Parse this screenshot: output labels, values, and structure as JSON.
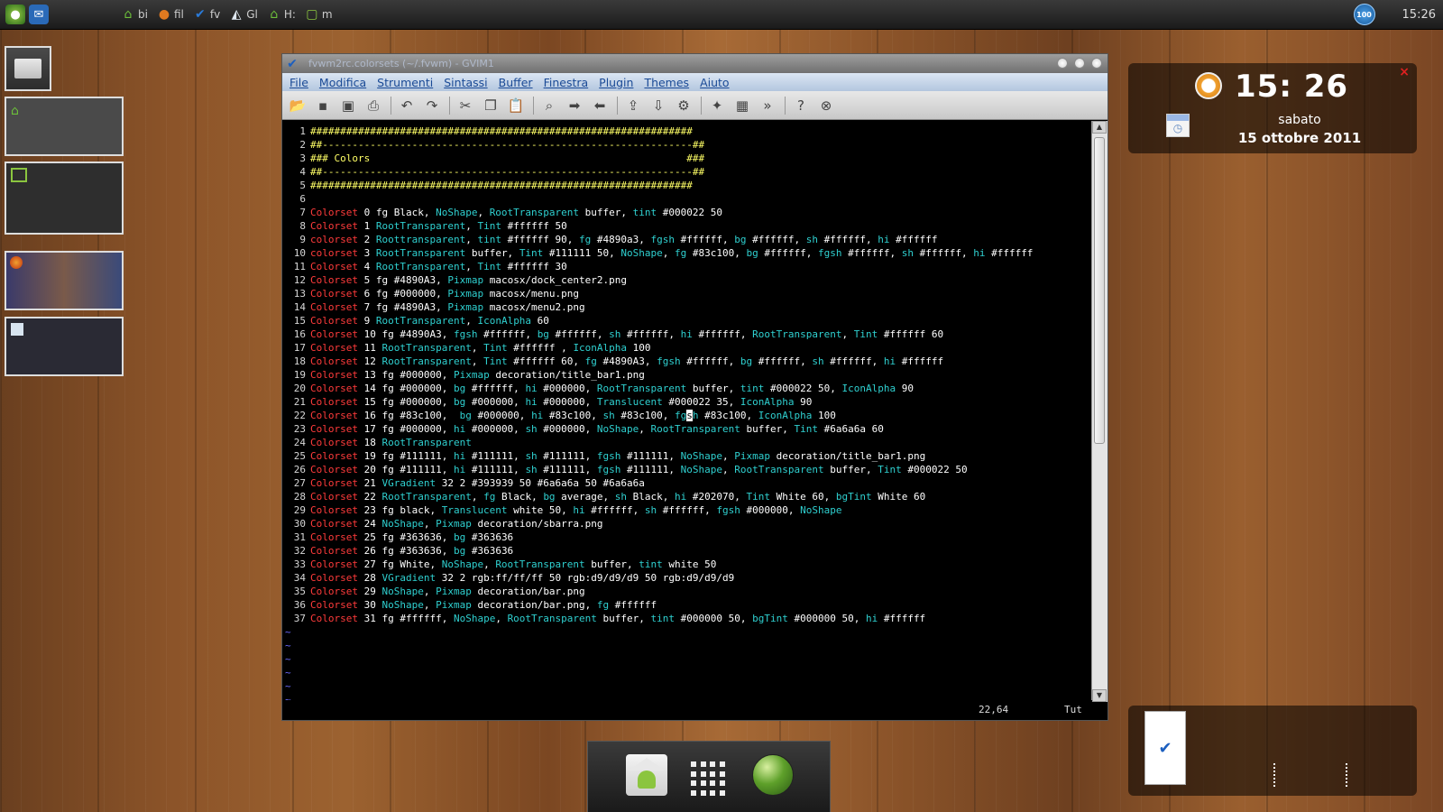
{
  "top_panel": {
    "launchers": [
      "globe-launcher",
      "chat-launcher"
    ],
    "tasks": [
      {
        "icon": "home-icon",
        "label": "bi"
      },
      {
        "icon": "firefox-icon",
        "label": "fil"
      },
      {
        "icon": "gvim-icon",
        "label": "fv"
      },
      {
        "icon": "inkscape-icon",
        "label": "Gl"
      },
      {
        "icon": "home-icon",
        "label": "H:"
      },
      {
        "icon": "terminal-icon",
        "label": "m"
      }
    ],
    "badge": "100",
    "clock": "15:26"
  },
  "gvim": {
    "title": "fvwm2rc.colorsets (~/.fvwm) - GVIM1",
    "menu": [
      "File",
      "Modifica",
      "Strumenti",
      "Sintassi",
      "Buffer",
      "Finestra",
      "Plugin",
      "Themes",
      "Aiuto"
    ],
    "status_pos": "22,64",
    "status_pct": "Tut"
  },
  "code_lines": [
    [
      [
        "#",
        "################################################################"
      ]
    ],
    [
      [
        "#",
        "##--------------------------------------------------------------##"
      ]
    ],
    [
      [
        "#",
        "### Colors                                                     ###"
      ]
    ],
    [
      [
        "#",
        "##--------------------------------------------------------------##"
      ]
    ],
    [
      [
        "#",
        "################################################################"
      ]
    ],
    [],
    [
      [
        "r",
        "Colorset"
      ],
      [
        "w",
        " 0 fg Black, "
      ],
      [
        "c",
        "NoShape"
      ],
      [
        "w",
        ", "
      ],
      [
        "c",
        "RootTransparent"
      ],
      [
        "w",
        " buffer, "
      ],
      [
        "c",
        "tint"
      ],
      [
        "w",
        " #000022 50"
      ]
    ],
    [
      [
        "r",
        "Colorset"
      ],
      [
        "w",
        " 1 "
      ],
      [
        "c",
        "RootTransparent"
      ],
      [
        "w",
        ", "
      ],
      [
        "c",
        "Tint"
      ],
      [
        "w",
        " #ffffff 50"
      ]
    ],
    [
      [
        "r",
        "colorset"
      ],
      [
        "w",
        " 2 "
      ],
      [
        "c",
        "Roottransparent"
      ],
      [
        "w",
        ", "
      ],
      [
        "c",
        "tint"
      ],
      [
        "w",
        " #ffffff 90, "
      ],
      [
        "c",
        "fg"
      ],
      [
        "w",
        " #4890a3, "
      ],
      [
        "c",
        "fgsh"
      ],
      [
        "w",
        " #ffffff, "
      ],
      [
        "c",
        "bg"
      ],
      [
        "w",
        " #ffffff, "
      ],
      [
        "c",
        "sh"
      ],
      [
        "w",
        " #ffffff, "
      ],
      [
        "c",
        "hi"
      ],
      [
        "w",
        " #ffffff"
      ]
    ],
    [
      [
        "r",
        "colorset"
      ],
      [
        "w",
        " 3 "
      ],
      [
        "c",
        "RootTransparent"
      ],
      [
        "w",
        " buffer, "
      ],
      [
        "c",
        "Tint"
      ],
      [
        "w",
        " #111111 50, "
      ],
      [
        "c",
        "NoShape"
      ],
      [
        "w",
        ", "
      ],
      [
        "c",
        "fg"
      ],
      [
        "w",
        " #83c100, "
      ],
      [
        "c",
        "bg"
      ],
      [
        "w",
        " #ffffff, "
      ],
      [
        "c",
        "fgsh"
      ],
      [
        "w",
        " #ffffff, "
      ],
      [
        "c",
        "sh"
      ],
      [
        "w",
        " #ffffff, "
      ],
      [
        "c",
        "hi"
      ],
      [
        "w",
        " #ffffff"
      ]
    ],
    [
      [
        "r",
        "Colorset"
      ],
      [
        "w",
        " 4 "
      ],
      [
        "c",
        "RootTransparent"
      ],
      [
        "w",
        ", "
      ],
      [
        "c",
        "Tint"
      ],
      [
        "w",
        " #ffffff 30"
      ]
    ],
    [
      [
        "r",
        "Colorset"
      ],
      [
        "w",
        " 5 fg #4890A3, "
      ],
      [
        "c",
        "Pixmap"
      ],
      [
        "w",
        " macosx/dock_center2.png"
      ]
    ],
    [
      [
        "r",
        "Colorset"
      ],
      [
        "w",
        " 6 fg #000000, "
      ],
      [
        "c",
        "Pixmap"
      ],
      [
        "w",
        " macosx/menu.png"
      ]
    ],
    [
      [
        "r",
        "Colorset"
      ],
      [
        "w",
        " 7 fg #4890A3, "
      ],
      [
        "c",
        "Pixmap"
      ],
      [
        "w",
        " macosx/menu2.png"
      ]
    ],
    [
      [
        "r",
        "Colorset"
      ],
      [
        "w",
        " 9 "
      ],
      [
        "c",
        "RootTransparent"
      ],
      [
        "w",
        ", "
      ],
      [
        "c",
        "IconAlpha"
      ],
      [
        "w",
        " 60"
      ]
    ],
    [
      [
        "r",
        "Colorset"
      ],
      [
        "w",
        " 10 fg #4890A3, "
      ],
      [
        "c",
        "fgsh"
      ],
      [
        "w",
        " #ffffff, "
      ],
      [
        "c",
        "bg"
      ],
      [
        "w",
        " #ffffff, "
      ],
      [
        "c",
        "sh"
      ],
      [
        "w",
        " #ffffff, "
      ],
      [
        "c",
        "hi"
      ],
      [
        "w",
        " #ffffff, "
      ],
      [
        "c",
        "RootTransparent"
      ],
      [
        "w",
        ", "
      ],
      [
        "c",
        "Tint"
      ],
      [
        "w",
        " #ffffff 60"
      ]
    ],
    [
      [
        "r",
        "Colorset"
      ],
      [
        "w",
        " 11 "
      ],
      [
        "c",
        "RootTransparent"
      ],
      [
        "w",
        ", "
      ],
      [
        "c",
        "Tint"
      ],
      [
        "w",
        " #ffffff , "
      ],
      [
        "c",
        "IconAlpha"
      ],
      [
        "w",
        " 100"
      ]
    ],
    [
      [
        "r",
        "Colorset"
      ],
      [
        "w",
        " 12 "
      ],
      [
        "c",
        "RootTransparent"
      ],
      [
        "w",
        ", "
      ],
      [
        "c",
        "Tint"
      ],
      [
        "w",
        " #ffffff 60, "
      ],
      [
        "c",
        "fg"
      ],
      [
        "w",
        " #4890A3, "
      ],
      [
        "c",
        "fgsh"
      ],
      [
        "w",
        " #ffffff, "
      ],
      [
        "c",
        "bg"
      ],
      [
        "w",
        " #ffffff, "
      ],
      [
        "c",
        "sh"
      ],
      [
        "w",
        " #ffffff, "
      ],
      [
        "c",
        "hi"
      ],
      [
        "w",
        " #ffffff"
      ]
    ],
    [
      [
        "r",
        "Colorset"
      ],
      [
        "w",
        " 13 fg #000000, "
      ],
      [
        "c",
        "Pixmap"
      ],
      [
        "w",
        " decoration/title_bar1.png"
      ]
    ],
    [
      [
        "r",
        "Colorset"
      ],
      [
        "w",
        " 14 fg #000000, "
      ],
      [
        "c",
        "bg"
      ],
      [
        "w",
        " #ffffff, "
      ],
      [
        "c",
        "hi"
      ],
      [
        "w",
        " #000000, "
      ],
      [
        "c",
        "RootTransparent"
      ],
      [
        "w",
        " buffer, "
      ],
      [
        "c",
        "tint"
      ],
      [
        "w",
        " #000022 50, "
      ],
      [
        "c",
        "IconAlpha"
      ],
      [
        "w",
        " 90"
      ]
    ],
    [
      [
        "r",
        "Colorset"
      ],
      [
        "w",
        " 15 fg #000000, "
      ],
      [
        "c",
        "bg"
      ],
      [
        "w",
        " #000000, "
      ],
      [
        "c",
        "hi"
      ],
      [
        "w",
        " #000000, "
      ],
      [
        "c",
        "Translucent"
      ],
      [
        "w",
        " #000022 35, "
      ],
      [
        "c",
        "IconAlpha"
      ],
      [
        "w",
        " 90"
      ]
    ],
    [
      [
        "r",
        "Colorset"
      ],
      [
        "w",
        " 16 fg #83c100,  "
      ],
      [
        "c",
        "bg"
      ],
      [
        "w",
        " #000000, "
      ],
      [
        "c",
        "hi"
      ],
      [
        "w",
        " #83c100, "
      ],
      [
        "c",
        "sh"
      ],
      [
        "w",
        " #83c100, "
      ],
      [
        "c",
        "fg"
      ],
      [
        "k",
        "s"
      ],
      [
        "c",
        "h"
      ],
      [
        "w",
        " #83c100, "
      ],
      [
        "c",
        "IconAlpha"
      ],
      [
        "w",
        " 100"
      ]
    ],
    [
      [
        "r",
        "Colorset"
      ],
      [
        "w",
        " 17 fg #000000, "
      ],
      [
        "c",
        "hi"
      ],
      [
        "w",
        " #000000, "
      ],
      [
        "c",
        "sh"
      ],
      [
        "w",
        " #000000, "
      ],
      [
        "c",
        "NoShape"
      ],
      [
        "w",
        ", "
      ],
      [
        "c",
        "RootTransparent"
      ],
      [
        "w",
        " buffer, "
      ],
      [
        "c",
        "Tint"
      ],
      [
        "w",
        " #6a6a6a 60"
      ]
    ],
    [
      [
        "r",
        "Colorset"
      ],
      [
        "w",
        " 18 "
      ],
      [
        "c",
        "RootTransparent"
      ]
    ],
    [
      [
        "r",
        "Colorset"
      ],
      [
        "w",
        " 19 fg #111111, "
      ],
      [
        "c",
        "hi"
      ],
      [
        "w",
        " #111111, "
      ],
      [
        "c",
        "sh"
      ],
      [
        "w",
        " #111111, "
      ],
      [
        "c",
        "fgsh"
      ],
      [
        "w",
        " #111111, "
      ],
      [
        "c",
        "NoShape"
      ],
      [
        "w",
        ", "
      ],
      [
        "c",
        "Pixmap"
      ],
      [
        "w",
        " decoration/title_bar1.png"
      ]
    ],
    [
      [
        "r",
        "Colorset"
      ],
      [
        "w",
        " 20 fg #111111, "
      ],
      [
        "c",
        "hi"
      ],
      [
        "w",
        " #111111, "
      ],
      [
        "c",
        "sh"
      ],
      [
        "w",
        " #111111, "
      ],
      [
        "c",
        "fgsh"
      ],
      [
        "w",
        " #111111, "
      ],
      [
        "c",
        "NoShape"
      ],
      [
        "w",
        ", "
      ],
      [
        "c",
        "RootTransparent"
      ],
      [
        "w",
        " buffer, "
      ],
      [
        "c",
        "Tint"
      ],
      [
        "w",
        " #000022 50"
      ]
    ],
    [
      [
        "r",
        "Colorset"
      ],
      [
        "w",
        " 21 "
      ],
      [
        "c",
        "VGradient"
      ],
      [
        "w",
        " 32 2 #393939 50 #6a6a6a 50 #6a6a6a"
      ]
    ],
    [
      [
        "r",
        "Colorset"
      ],
      [
        "w",
        " 22 "
      ],
      [
        "c",
        "RootTransparent"
      ],
      [
        "w",
        ", "
      ],
      [
        "c",
        "fg"
      ],
      [
        "w",
        " Black, "
      ],
      [
        "c",
        "bg"
      ],
      [
        "w",
        " average, "
      ],
      [
        "c",
        "sh"
      ],
      [
        "w",
        " Black, "
      ],
      [
        "c",
        "hi"
      ],
      [
        "w",
        " #202070, "
      ],
      [
        "c",
        "Tint"
      ],
      [
        "w",
        " White 60, "
      ],
      [
        "c",
        "bgTint"
      ],
      [
        "w",
        " White 60"
      ]
    ],
    [
      [
        "r",
        "Colorset"
      ],
      [
        "w",
        " 23 fg black, "
      ],
      [
        "c",
        "Translucent"
      ],
      [
        "w",
        " white 50, "
      ],
      [
        "c",
        "hi"
      ],
      [
        "w",
        " #ffffff, "
      ],
      [
        "c",
        "sh"
      ],
      [
        "w",
        " #ffffff, "
      ],
      [
        "c",
        "fgsh"
      ],
      [
        "w",
        " #000000, "
      ],
      [
        "c",
        "NoShape"
      ]
    ],
    [
      [
        "r",
        "Colorset"
      ],
      [
        "w",
        " 24 "
      ],
      [
        "c",
        "NoShape"
      ],
      [
        "w",
        ", "
      ],
      [
        "c",
        "Pixmap"
      ],
      [
        "w",
        " decoration/sbarra.png"
      ]
    ],
    [
      [
        "r",
        "Colorset"
      ],
      [
        "w",
        " 25 fg #363636, "
      ],
      [
        "c",
        "bg"
      ],
      [
        "w",
        " #363636"
      ]
    ],
    [
      [
        "r",
        "Colorset"
      ],
      [
        "w",
        " 26 fg #363636, "
      ],
      [
        "c",
        "bg"
      ],
      [
        "w",
        " #363636"
      ]
    ],
    [
      [
        "r",
        "Colorset"
      ],
      [
        "w",
        " 27 fg White, "
      ],
      [
        "c",
        "NoShape"
      ],
      [
        "w",
        ", "
      ],
      [
        "c",
        "RootTransparent"
      ],
      [
        "w",
        " buffer, "
      ],
      [
        "c",
        "tint"
      ],
      [
        "w",
        " white 50"
      ]
    ],
    [
      [
        "r",
        "Colorset"
      ],
      [
        "w",
        " 28 "
      ],
      [
        "c",
        "VGradient"
      ],
      [
        "w",
        " 32 2 rgb:ff/ff/ff 50 rgb:d9/d9/d9 50 rgb:d9/d9/d9"
      ]
    ],
    [
      [
        "r",
        "Colorset"
      ],
      [
        "w",
        " 29 "
      ],
      [
        "c",
        "NoShape"
      ],
      [
        "w",
        ", "
      ],
      [
        "c",
        "Pixmap"
      ],
      [
        "w",
        " decoration/bar.png"
      ]
    ],
    [
      [
        "r",
        "Colorset"
      ],
      [
        "w",
        " 30 "
      ],
      [
        "c",
        "NoShape"
      ],
      [
        "w",
        ", "
      ],
      [
        "c",
        "Pixmap"
      ],
      [
        "w",
        " decoration/bar.png, "
      ],
      [
        "c",
        "fg"
      ],
      [
        "w",
        " #ffffff"
      ]
    ],
    [
      [
        "r",
        "Colorset"
      ],
      [
        "w",
        " 31 fg #ffffff, "
      ],
      [
        "c",
        "NoShape"
      ],
      [
        "w",
        ", "
      ],
      [
        "c",
        "RootTransparent"
      ],
      [
        "w",
        " buffer, "
      ],
      [
        "c",
        "tint"
      ],
      [
        "w",
        " #000000 50, "
      ],
      [
        "c",
        "bgTint"
      ],
      [
        "w",
        " #000000 50, "
      ],
      [
        "c",
        "hi"
      ],
      [
        "w",
        " #ffffff"
      ]
    ]
  ],
  "tilde_lines": [
    "~",
    "~",
    "~",
    "~",
    "~",
    "~"
  ],
  "clock_widget": {
    "time": "15: 26",
    "day": "sabato",
    "date": "15 ottobre 2011",
    "close": "×"
  },
  "colors": {
    "keyword": "#ff3b3b",
    "option": "#2fd0d0",
    "comment": "#ffff66",
    "text": "#ffffff"
  }
}
